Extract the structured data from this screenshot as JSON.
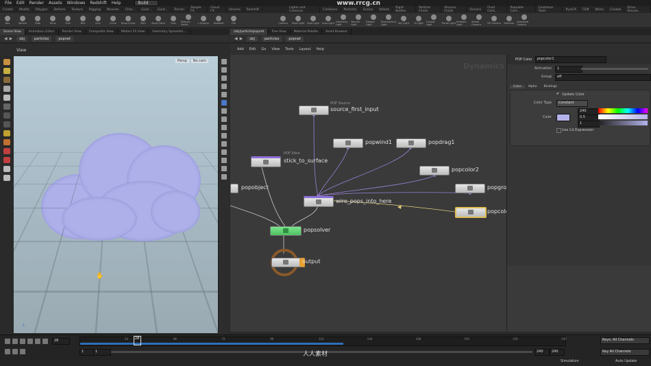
{
  "menu": [
    "File",
    "Edit",
    "Render",
    "Assets",
    "Windows",
    "Redshift",
    "Help"
  ],
  "desktop": "Build",
  "shelf_tabs": [
    "Create",
    "Modify",
    "Polygon",
    "Deform",
    "Texture",
    "Rigging",
    "Muscles",
    "Char...",
    "Guid...",
    "Guid...",
    "Terrain",
    "Simple FX",
    "Cloud FX",
    "Volume",
    "Redshift"
  ],
  "shelf_tools": [
    "Box",
    "Sphere",
    "Tube",
    "Torus",
    "Grid",
    "Null",
    "Line",
    "Circle",
    "Draw Curve",
    "Path",
    "Spray Paint",
    "Font",
    "Platonic Solids",
    "L-System",
    "Metaball",
    "File"
  ],
  "right_shelf_tabs": [
    "Lights and Cameras",
    "Collisions",
    "Particles",
    "Grains",
    "Vellum",
    "Rigid Bodies",
    "Particle Fluids",
    "Viscous Fluids",
    "Oceans",
    "Fluid Cont...",
    "Populate Cont...",
    "Container Tools",
    "PyroFX",
    "FEM",
    "Wires",
    "Crowds",
    "Drive Simula..."
  ],
  "right_shelf_tools": [
    "Camera",
    "Point Light",
    "Spot Light",
    "Area Light",
    "Geometry Light",
    "Volume Light",
    "Distant Light",
    "Environment Light",
    "Sky Light",
    "GI Light",
    "Caustic Light",
    "Portal Light",
    "Ambient Light",
    "Stereo Camera",
    "VR Camera",
    "Switcher",
    "Gamepad Camera"
  ],
  "left_pane_tabs": [
    "Scene View",
    "Animation Editor",
    "Render View",
    "Composite View",
    "Motion FX View",
    "Geometry Spreadsh..."
  ],
  "right_pane_tabs": [
    "/obj/particle/popnet",
    "Tree View",
    "Material Palette",
    "Asset Browser"
  ],
  "path": [
    "obj",
    "particles",
    "popnet"
  ],
  "viewport": {
    "label": "View",
    "camera": "Persp",
    "light": "No cam"
  },
  "network_menu": [
    "Add",
    "Edit",
    "Go",
    "View",
    "Tools",
    "Layout",
    "Help"
  ],
  "watermark": "www.rrcg.cn",
  "network_title": "Dynamics",
  "nodes": {
    "source_type": "POP Source",
    "source_first_input": "source_first_input",
    "popwind1": "popwind1",
    "popdrag1": "popdrag1",
    "stick_type": "POP Stick",
    "stick_to_surface": "stick_to_surface",
    "popcolor2": "popcolor2",
    "popobject": "popobject",
    "popgro": "popgro",
    "wire_pops": "wire_pops_into_here",
    "popcolo": "popcolo",
    "popsolver": "popsolver",
    "output": "output"
  },
  "params": {
    "node_type": "POP Color",
    "node_name": "popcolor1",
    "activation_label": "Activation",
    "activation_value": "1",
    "group_label": "Group",
    "group_value": "eff",
    "tabs": [
      "Color",
      "Alpha",
      "Bindings"
    ],
    "update_color": "Update Color",
    "color_type_label": "Color Type",
    "color_type_value": "Constant",
    "color_label": "Color",
    "color_r": "240",
    "color_g": "0.5",
    "color_b": "1",
    "use_cd": "Use Cd Expression",
    "swatch": "#b4b2ea"
  },
  "timeline": {
    "frame": "28",
    "ticks": [
      "24",
      "48",
      "72",
      "96",
      "120",
      "144",
      "168",
      "192",
      "216",
      "240"
    ],
    "start": "1",
    "start2": "1",
    "end": "240",
    "end2": "240",
    "playhead": 28,
    "total": 240,
    "cache_end": 130,
    "keys_label": "Keys: All Channels",
    "scope_label": "Key All Channels",
    "status_left": "Simulation",
    "status_right": "Auto Update",
    "watermark2": "人人素材"
  },
  "colors": {
    "accent": "#e8a030",
    "solver": "#5ad46e",
    "cloud": "#aeb0ea",
    "sky": "#b9cdd8",
    "cache": "#2d6fb8"
  }
}
